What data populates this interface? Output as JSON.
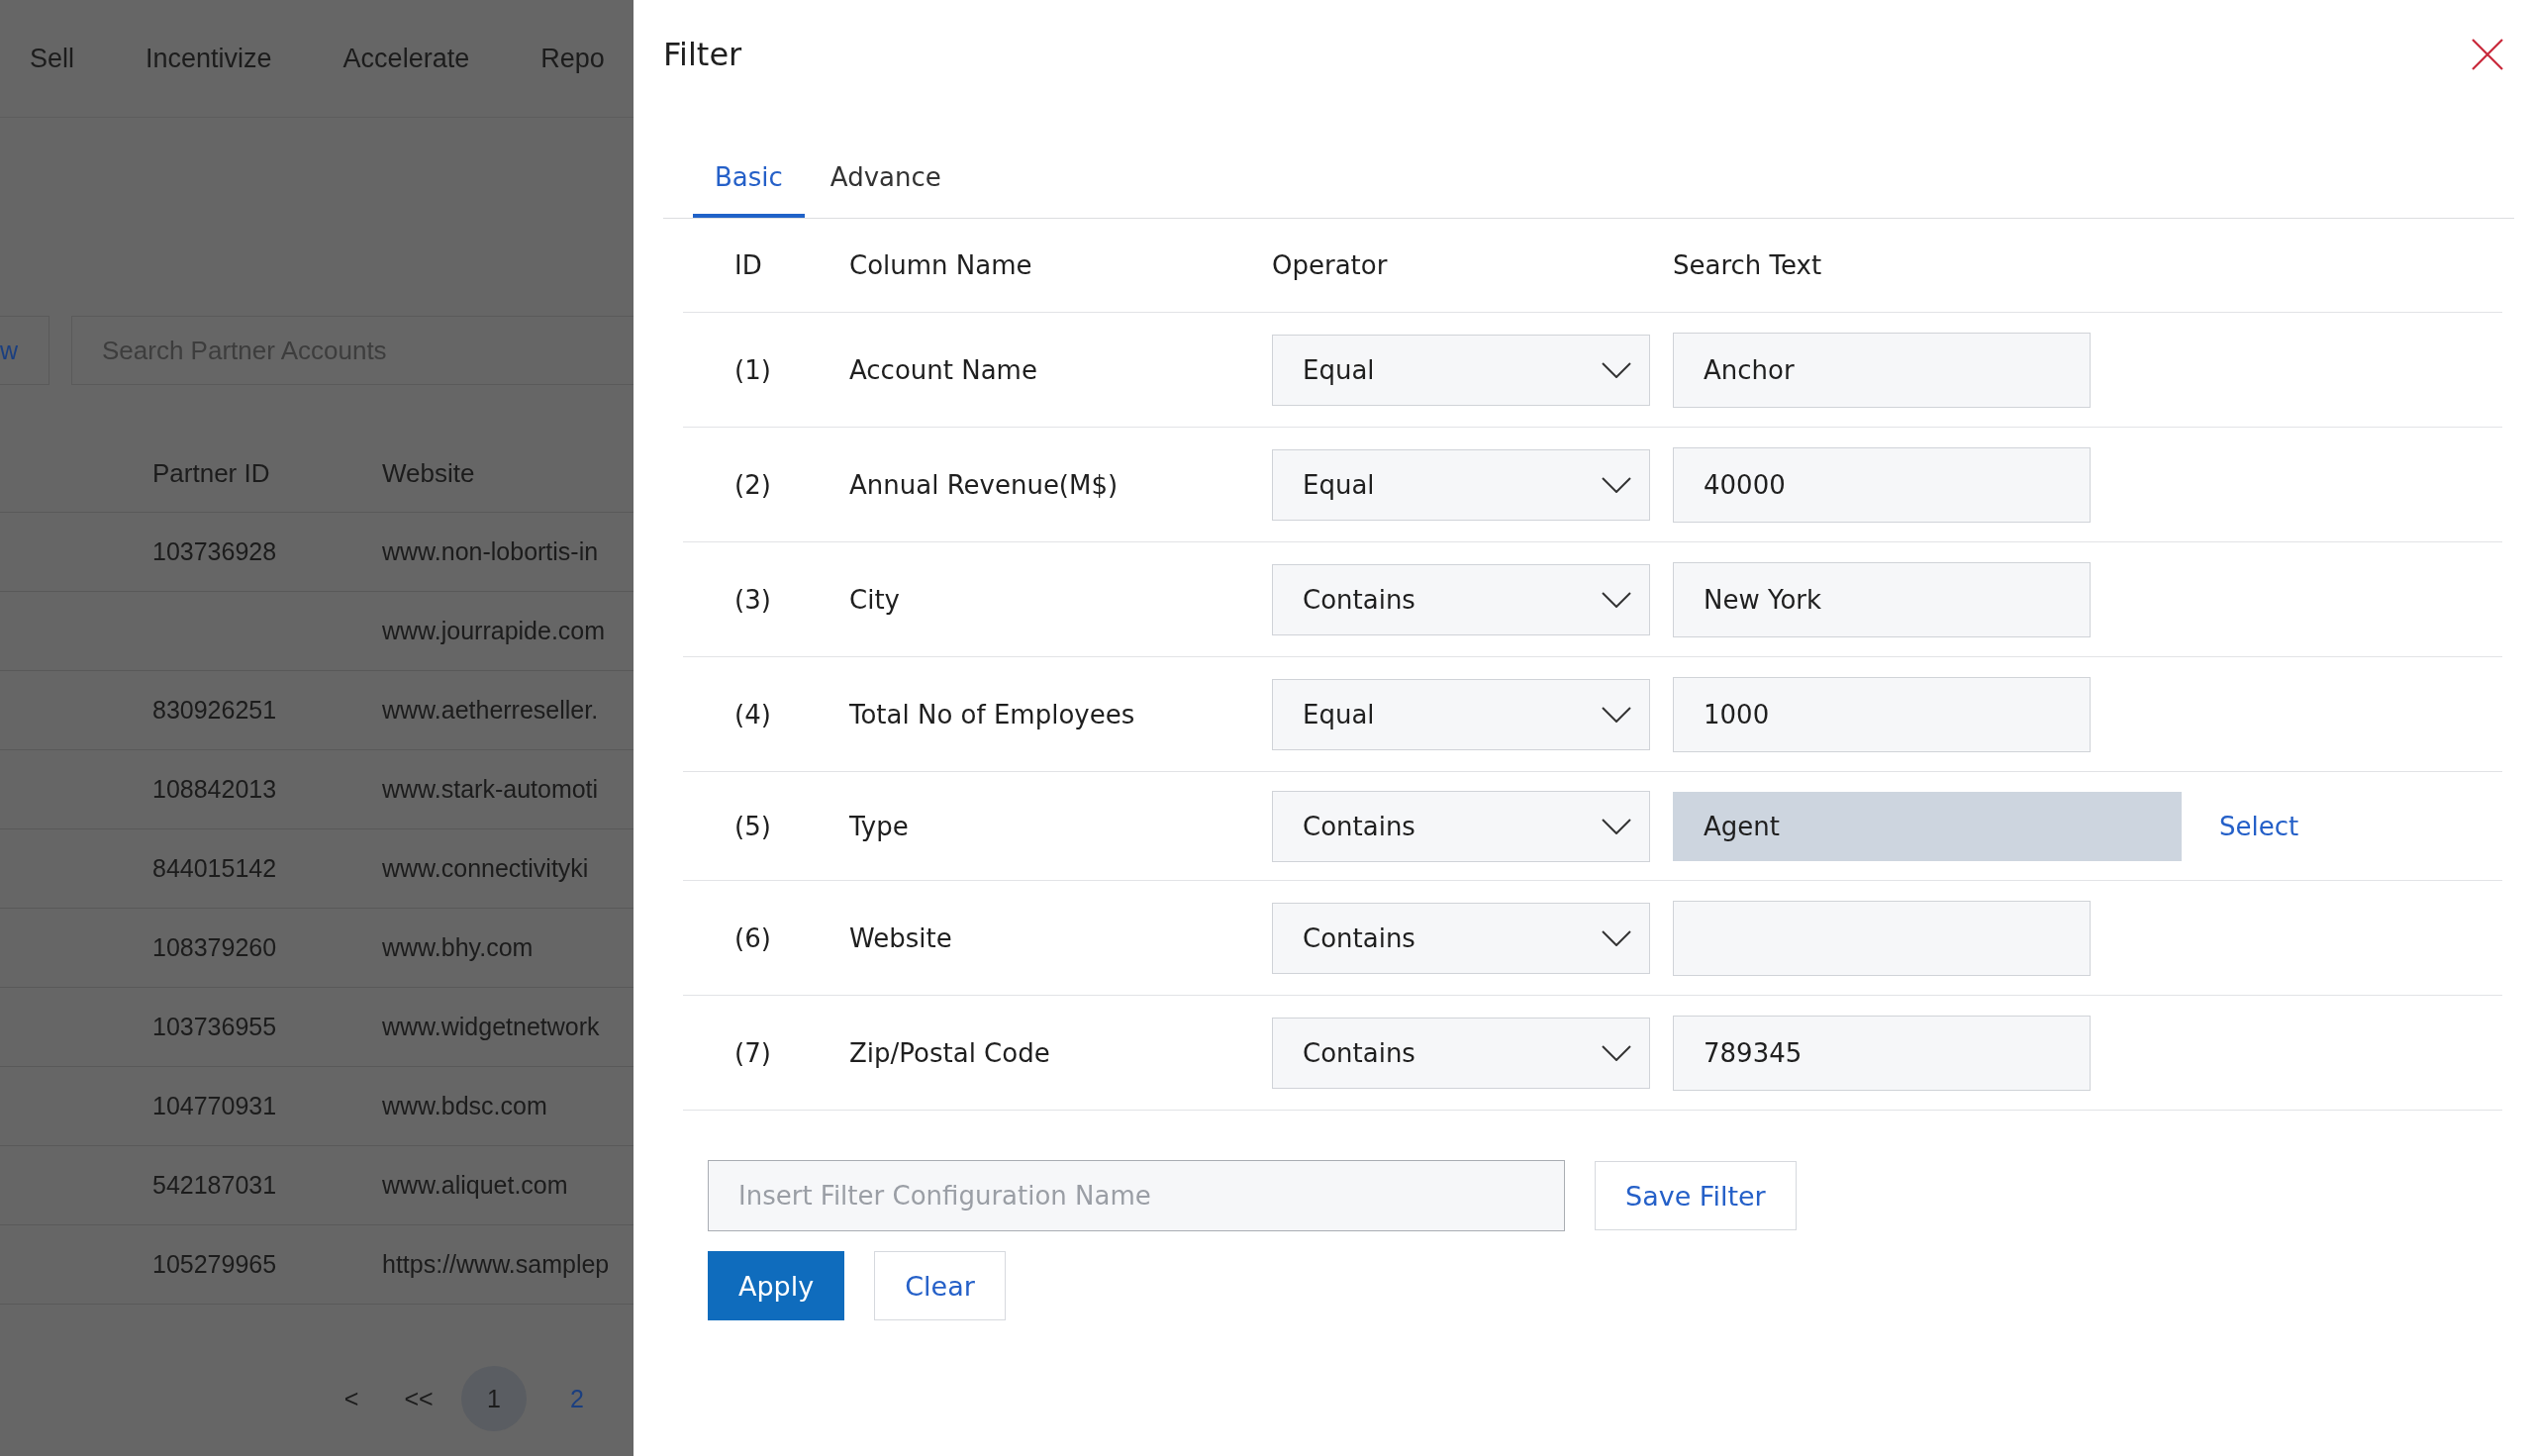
{
  "background": {
    "nav": [
      "Sell",
      "Incentivize",
      "Accelerate",
      "Repo"
    ],
    "view_button": "w",
    "search": {
      "placeholder": "Search Partner Accounts"
    },
    "table": {
      "columns": [
        "Partner ID",
        "Website"
      ],
      "rows": [
        [
          "103736928",
          "www.non-lobortis-in"
        ],
        [
          "",
          "www.jourrapide.com"
        ],
        [
          "830926251",
          "www.aetherreseller."
        ],
        [
          "108842013",
          "www.stark-automoti"
        ],
        [
          "844015142",
          "www.connectivityki"
        ],
        [
          "108379260",
          "www.bhy.com"
        ],
        [
          "103736955",
          "www.widgetnetwork"
        ],
        [
          "104770931",
          "www.bdsc.com"
        ],
        [
          "542187031",
          "www.aliquet.com"
        ],
        [
          "105279965",
          "https://www.samplep"
        ]
      ]
    },
    "pagination": [
      {
        "label": "<",
        "kind": "nav",
        "selected": false
      },
      {
        "label": "<<",
        "kind": "nav",
        "selected": false
      },
      {
        "label": "1",
        "kind": "page",
        "selected": true
      },
      {
        "label": "2",
        "kind": "page",
        "selected": false
      }
    ]
  },
  "filter_panel": {
    "title": "Filter",
    "tabs": [
      {
        "label": "Basic",
        "selected": true
      },
      {
        "label": "Advance",
        "selected": false
      }
    ],
    "columns": [
      "ID",
      "Column Name",
      "Operator",
      "Search Text"
    ],
    "rows": [
      {
        "id": "(1)",
        "column": "Account Name",
        "operator": "Equal",
        "kind": "text",
        "search_text": "Anchor"
      },
      {
        "id": "(2)",
        "column": "Annual Revenue(M$)",
        "operator": "Equal",
        "kind": "text",
        "search_text": "40000"
      },
      {
        "id": "(3)",
        "column": "City",
        "operator": "Contains",
        "kind": "text",
        "search_text": "New York"
      },
      {
        "id": "(4)",
        "column": "Total No of Employees",
        "operator": "Equal",
        "kind": "text",
        "search_text": "1000"
      },
      {
        "id": "(5)",
        "column": "Type",
        "operator": "Contains",
        "kind": "lookup",
        "search_text": "Agent",
        "link": "Select"
      },
      {
        "id": "(6)",
        "column": "Website",
        "operator": "Contains",
        "kind": "text"
      },
      {
        "id": "(7)",
        "column": "Zip/Postal Code",
        "operator": "Contains",
        "kind": "text",
        "search_text": "789345"
      }
    ],
    "config_name": {
      "placeholder": "Insert Filter Configuration Name"
    },
    "save_button": "Save Filter",
    "actions": [
      {
        "label": "Apply",
        "kind": "primary"
      },
      {
        "label": "Clear",
        "kind": "secondary"
      }
    ]
  }
}
